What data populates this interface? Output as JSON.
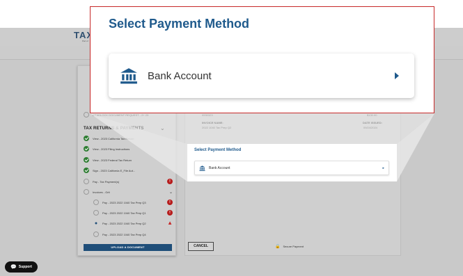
{
  "app": {
    "logo_text": "TAX",
    "logo_subtext": "Part of"
  },
  "sidebar": {
    "top_item_text": "DEADLOCK DOCUMENT REQUEST - 2+ 23",
    "section_title": "TAX RETURNS & PAYMENTS",
    "items": [
      {
        "label": "View - 2023 California Tax Return",
        "status": "done"
      },
      {
        "label": "View - 2023 Filing Instructions",
        "status": "done"
      },
      {
        "label": "View - 2023 Federal Tax Return",
        "status": "done"
      },
      {
        "label": "Sign - 2023 California E_File Aut...",
        "status": "done"
      },
      {
        "label": "Pay - Tax Payment(s)",
        "status": "empty",
        "badge": "!"
      },
      {
        "label": "Invoices - Grit",
        "status": "empty"
      }
    ],
    "invoices": [
      {
        "label": "Pay - 2023 2022 1040 Tax Prep Q3",
        "badge": "!"
      },
      {
        "label": "Pay - 2023 2022 1040 Tax Prep Q1",
        "badge": "!"
      },
      {
        "label": "Pay - 2023 2022 1040 Tax Prep Q2",
        "badge": "warning"
      },
      {
        "label": "Pay - 2023 2022 1040 Tax Prep Q4"
      }
    ],
    "upload_label": "UPLOAD A DOCUMENT"
  },
  "main": {
    "invoice_number": "0930323",
    "invoice_amount": "$130.00",
    "invoice_name_header": "INVOICE NAME:",
    "invoice_name": "2022 1040 Tax Prep Q2",
    "date_issued_header": "DATE ISSUED:",
    "date_issued": "09/24/2024",
    "cancel_label": "CANCEL",
    "secure_label": "Secure Payment"
  },
  "payment_dialog": {
    "title": "Select Payment Method",
    "options": [
      {
        "label": "Bank Account",
        "icon": "bank-icon"
      }
    ]
  },
  "support": {
    "label": "Support"
  },
  "colors": {
    "accent": "#1f5a8c",
    "callout_border": "#c62828",
    "success": "#2e7d32",
    "alert": "#b71c1c"
  }
}
